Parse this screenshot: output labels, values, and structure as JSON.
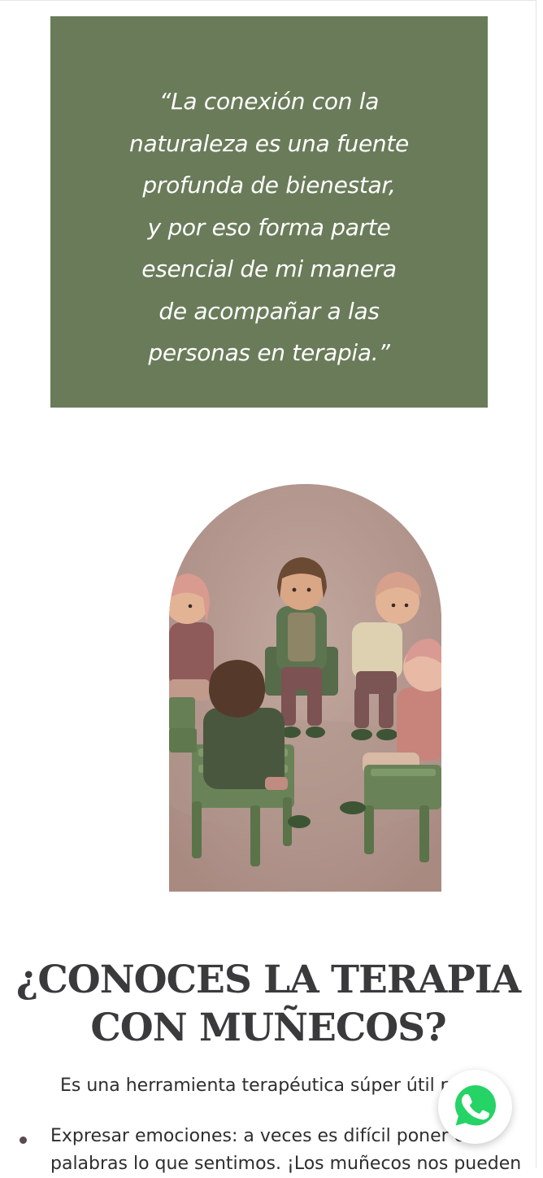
{
  "quote": {
    "lines": [
      "“La conexión con la",
      "naturaleza es una fuente",
      "profunda de bienestar,",
      "y por eso forma parte",
      "esencial de mi manera",
      "de acompañar a las",
      "personas en terapia.”"
    ]
  },
  "image": {
    "subject": "toy figures seated in a circle on chairs (therapy group)"
  },
  "section": {
    "title_line1": "¿CONOCES LA TERAPIA",
    "title_line2": "CON MUÑECOS?",
    "intro": "Es una herramienta terapéutica súper útil para:",
    "bullets": [
      {
        "line1": "Expresar emociones: a veces es difícil poner en",
        "line2": "palabras lo que sentimos. ¡Los muñecos nos pueden"
      }
    ]
  },
  "whatsapp": {
    "icon": "whatsapp-icon",
    "color": "#25d366"
  },
  "colors": {
    "quote_bg": "#6a7b59",
    "heading": "#3a3a3c",
    "image_bg": "#b99f97"
  }
}
